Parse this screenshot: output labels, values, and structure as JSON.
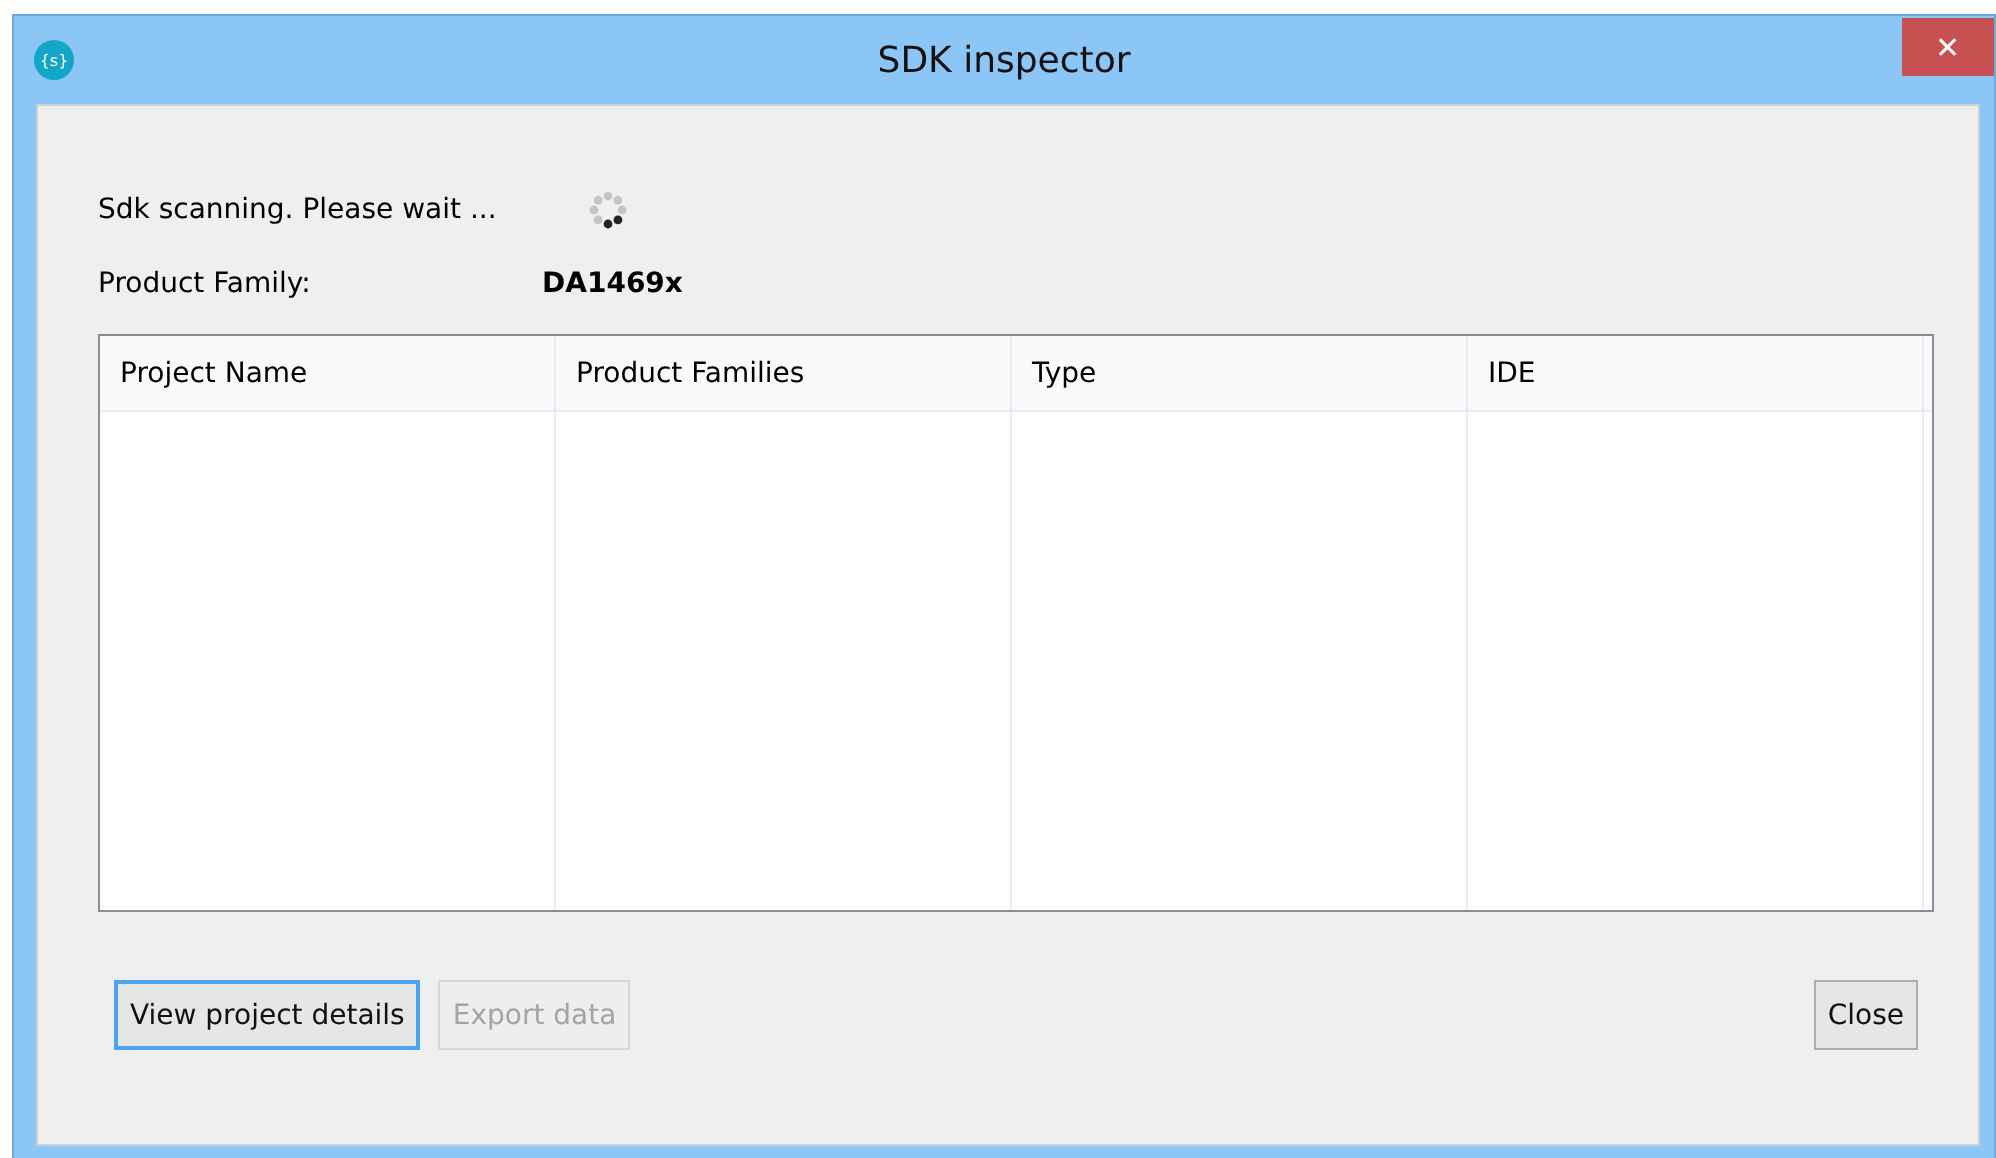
{
  "window": {
    "title": "SDK inspector",
    "app_icon_text": "{s}",
    "close_glyph": "✕"
  },
  "status": {
    "text": "Sdk scanning. Please wait ...",
    "busy": true
  },
  "product_family": {
    "label": "Product Family:",
    "value": "DA1469x"
  },
  "table": {
    "columns": [
      "Project Name",
      "Product Families",
      "Type",
      "IDE"
    ]
  },
  "buttons": [
    {
      "label": "View project details",
      "disabled": false,
      "focused": true
    },
    {
      "label": "Export data",
      "disabled": true,
      "focused": false
    }
  ],
  "close_button": {
    "label": "Close"
  }
}
